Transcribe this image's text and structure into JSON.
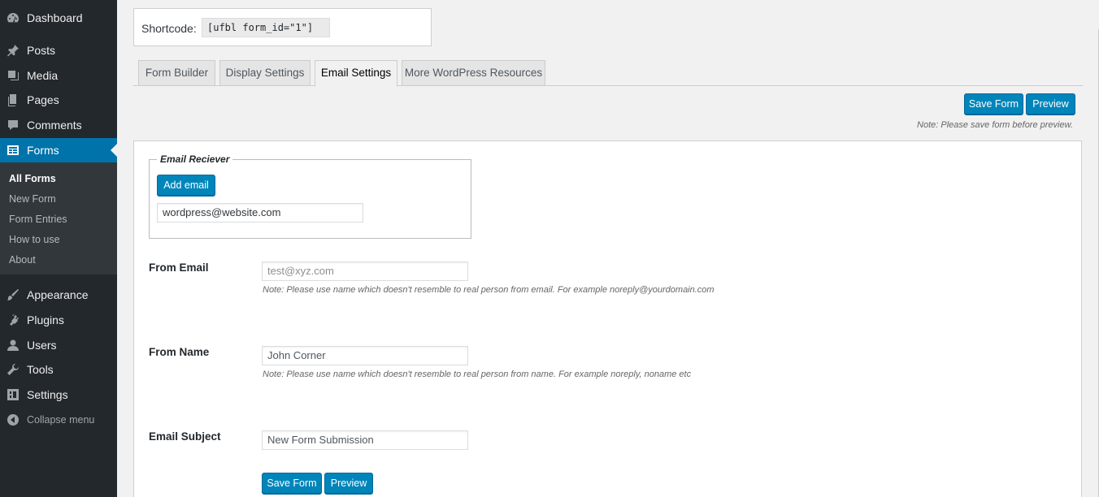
{
  "sidebar": {
    "items": [
      {
        "label": "Dashboard",
        "icon": "dashboard-icon"
      },
      {
        "label": "Posts",
        "icon": "pin-icon"
      },
      {
        "label": "Media",
        "icon": "media-icon"
      },
      {
        "label": "Pages",
        "icon": "pages-icon"
      },
      {
        "label": "Comments",
        "icon": "comment-icon"
      },
      {
        "label": "Forms",
        "icon": "forms-icon"
      },
      {
        "label": "Appearance",
        "icon": "brush-icon"
      },
      {
        "label": "Plugins",
        "icon": "plug-icon"
      },
      {
        "label": "Users",
        "icon": "user-icon"
      },
      {
        "label": "Tools",
        "icon": "wrench-icon"
      },
      {
        "label": "Settings",
        "icon": "settings-icon"
      }
    ],
    "submenu": [
      "All Forms",
      "New Form",
      "Form Entries",
      "How to use",
      "About"
    ],
    "collapse_label": "Collapse menu"
  },
  "shortcode": {
    "label": "Shortcode:",
    "value": "[ufbl form_id=\"1\"]"
  },
  "tabs": [
    "Form Builder",
    "Display Settings",
    "Email Settings",
    "More WordPress Resources"
  ],
  "toolbar": {
    "save_label": "Save Form",
    "preview_label": "Preview",
    "note": "Note: Please save form before preview."
  },
  "email_receiver": {
    "legend": "Email Reciever",
    "add_label": "Add email",
    "email": "wordpress@website.com"
  },
  "from_email": {
    "label": "From Email",
    "placeholder": "test@xyz.com",
    "note": "Note: Please use name which doesn't resemble to real person from email. For example noreply@yourdomain.com"
  },
  "from_name": {
    "label": "From Name",
    "value": "John Corner",
    "note": "Note: Please use name which doesn't resemble to real person from name. For example noreply, noname etc"
  },
  "email_subject": {
    "label": "Email Subject",
    "value": "New Form Submission"
  },
  "bottom": {
    "save_label": "Save Form",
    "preview_label": "Preview"
  },
  "colors": {
    "primary": "#0085ba",
    "sidebar": "#23282d",
    "active": "#0073aa"
  }
}
